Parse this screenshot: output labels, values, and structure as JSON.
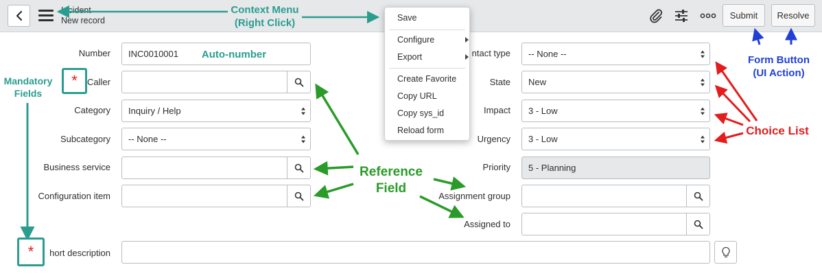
{
  "header": {
    "record_type": "Incident",
    "record_name": "New record",
    "buttons": {
      "submit": "Submit",
      "resolve": "Resolve"
    }
  },
  "context_menu": {
    "items": [
      "Save",
      "Configure",
      "Export",
      "Create Favorite",
      "Copy URL",
      "Copy sys_id",
      "Reload form"
    ]
  },
  "form": {
    "left": {
      "number": {
        "label": "Number",
        "value": "INC0010001"
      },
      "caller": {
        "label": "Caller",
        "value": ""
      },
      "category": {
        "label": "Category",
        "value": "Inquiry / Help"
      },
      "subcategory": {
        "label": "Subcategory",
        "value": "-- None --"
      },
      "business_service": {
        "label": "Business service",
        "value": ""
      },
      "configuration_item": {
        "label": "Configuration item",
        "value": ""
      }
    },
    "right": {
      "contact_type": {
        "label": "ntact type",
        "value": "-- None --"
      },
      "state": {
        "label": "State",
        "value": "New"
      },
      "impact": {
        "label": "Impact",
        "value": "3 - Low"
      },
      "urgency": {
        "label": "Urgency",
        "value": "3 - Low"
      },
      "priority": {
        "label": "Priority",
        "value": "5 - Planning"
      },
      "assignment_group": {
        "label": "Assignment group",
        "value": ""
      },
      "assigned_to": {
        "label": "Assigned to",
        "value": ""
      }
    },
    "short_description": {
      "label": "hort description",
      "value": ""
    }
  },
  "annotations": {
    "context_menu": [
      "Context Menu",
      "(Right Click)"
    ],
    "auto_number": "Auto-number",
    "mandatory_fields": [
      "Mandatory",
      "Fields"
    ],
    "reference_field": [
      "Reference",
      "Field"
    ],
    "form_button": [
      "Form Button",
      "(UI Action)"
    ],
    "choice_list": "Choice List",
    "mandatory_symbol": "*"
  },
  "colors": {
    "teal": "#2a9d8f",
    "green": "#2a9b28",
    "red": "#e31c1c",
    "blue": "#1f3fd6",
    "header_bg": "#e6e8ea"
  },
  "icons": {
    "back": "chevron-left-icon",
    "menu": "hamburger-icon",
    "attachment": "paperclip-icon",
    "personalize": "sliders-icon",
    "more": "more-options-icon",
    "lookup": "search-icon",
    "hint": "lightbulb-icon"
  }
}
